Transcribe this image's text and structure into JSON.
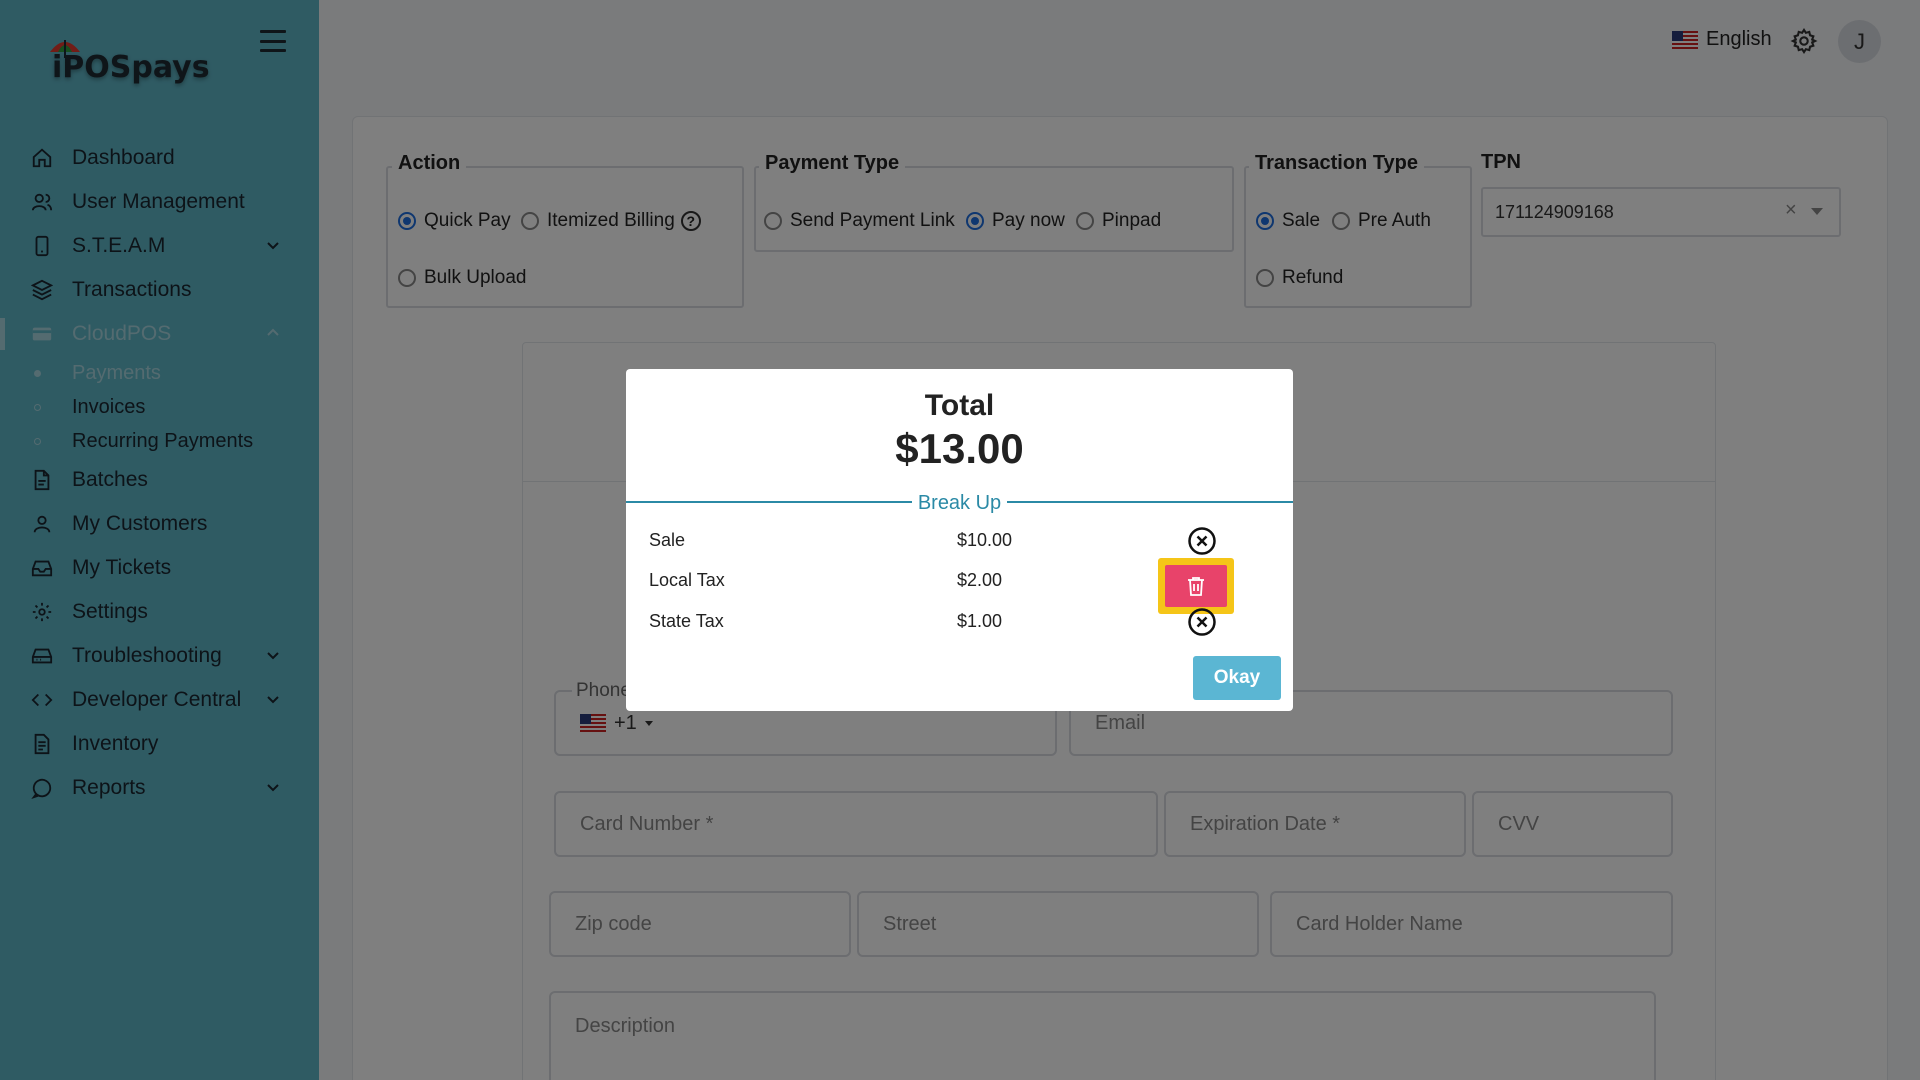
{
  "brand": {
    "logo_text": "iPOSpays"
  },
  "sidebar": {
    "items": [
      {
        "label": "Dashboard"
      },
      {
        "label": "User Management"
      },
      {
        "label": "S.T.E.A.M"
      },
      {
        "label": "Transactions"
      },
      {
        "label": "CloudPOS"
      },
      {
        "label": "Batches"
      },
      {
        "label": "My Customers"
      },
      {
        "label": "My Tickets"
      },
      {
        "label": "Settings"
      },
      {
        "label": "Troubleshooting"
      },
      {
        "label": "Developer Central"
      },
      {
        "label": "Inventory"
      },
      {
        "label": "Reports"
      }
    ],
    "cloudpos_sub": [
      {
        "label": "Payments"
      },
      {
        "label": "Invoices"
      },
      {
        "label": "Recurring Payments"
      }
    ]
  },
  "header": {
    "language": "English",
    "avatar_initial": "J"
  },
  "form": {
    "action": {
      "title": "Action",
      "options": [
        "Quick Pay",
        "Itemized Billing",
        "Bulk Upload"
      ],
      "selected": "Quick Pay"
    },
    "payment_type": {
      "title": "Payment Type",
      "options": [
        "Send Payment Link",
        "Pay now",
        "Pinpad"
      ],
      "selected": "Pay now"
    },
    "transaction_type": {
      "title": "Transaction Type",
      "options": [
        "Sale",
        "Pre Auth",
        "Refund"
      ],
      "selected": "Sale"
    },
    "tpn": {
      "label": "TPN",
      "value": "171124909168"
    },
    "fields": {
      "phone_label": "Phone",
      "phone_code": "+1",
      "email": "Email",
      "card_number": "Card Number *",
      "expiration": "Expiration Date *",
      "cvv": "CVV",
      "zip": "Zip code",
      "street": "Street",
      "card_holder": "Card Holder Name",
      "description": "Description"
    }
  },
  "modal": {
    "total_label": "Total",
    "total_amount": "$13.00",
    "breakup_label": "Break Up",
    "rows": [
      {
        "name": "Sale",
        "amount": "$10.00"
      },
      {
        "name": "Local Tax",
        "amount": "$2.00"
      },
      {
        "name": "State Tax",
        "amount": "$1.00"
      }
    ],
    "okay_label": "Okay"
  },
  "colors": {
    "sidebar_bg": "#5fb6c7",
    "accent_blue": "#1e6fe0",
    "delete_red": "#e8436a",
    "highlight_yellow": "#f5c518",
    "okay_button": "#5bb6d3"
  }
}
